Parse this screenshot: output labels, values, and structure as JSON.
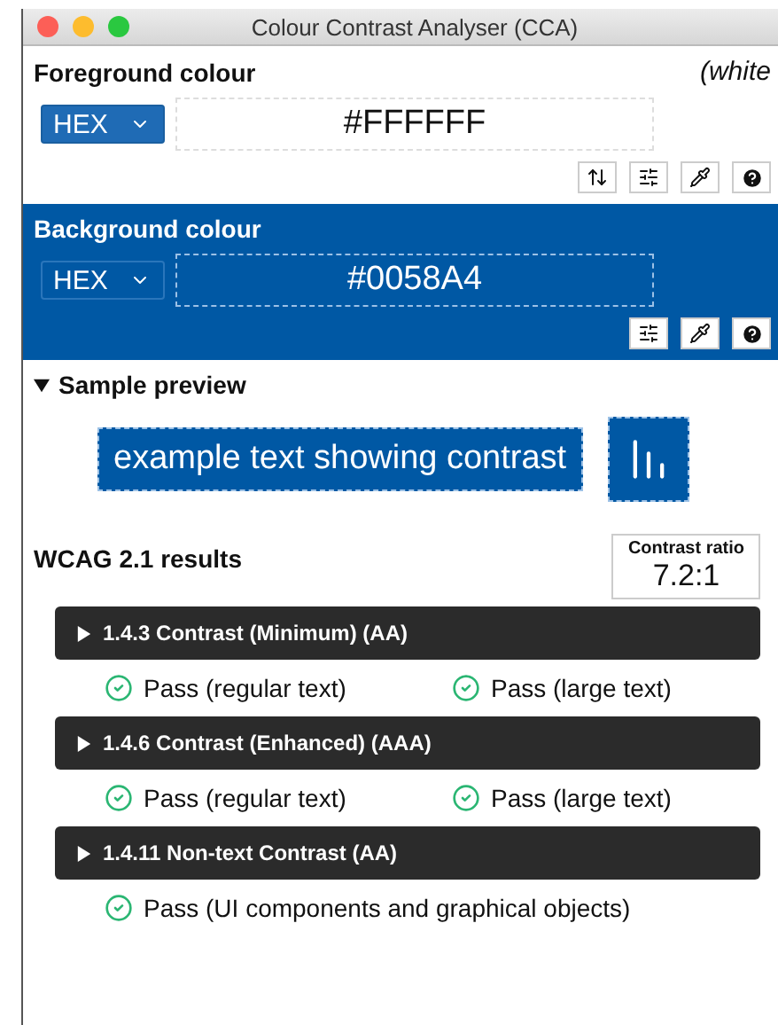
{
  "window": {
    "title": "Colour Contrast Analyser (CCA)"
  },
  "foreground": {
    "title": "Foreground colour",
    "name": "(white",
    "format": "HEX",
    "value": "#FFFFFF",
    "tools": [
      {
        "kind": "swap"
      },
      {
        "kind": "adjust"
      },
      {
        "kind": "picker"
      },
      {
        "kind": "help"
      }
    ]
  },
  "background": {
    "title": "Background colour",
    "format": "HEX",
    "value": "#0058A4",
    "tools": [
      {
        "kind": "adjust"
      },
      {
        "kind": "picker"
      },
      {
        "kind": "help"
      }
    ]
  },
  "sample": {
    "title": "Sample preview",
    "expanded": true,
    "text": "example text showing contrast"
  },
  "results": {
    "title": "WCAG 2.1 results",
    "ratio_label": "Contrast ratio",
    "ratio": "7.2:1",
    "criteria": [
      {
        "label": "1.4.3 Contrast (Minimum) (AA)",
        "expanded": false,
        "checks": [
          {
            "text": "Pass (regular text)",
            "passed": true
          },
          {
            "text": "Pass (large text)",
            "passed": true
          }
        ]
      },
      {
        "label": "1.4.6 Contrast (Enhanced) (AAA)",
        "expanded": false,
        "checks": [
          {
            "text": "Pass (regular text)",
            "passed": true
          },
          {
            "text": "Pass (large text)",
            "passed": true
          }
        ]
      },
      {
        "label": "1.4.11 Non-text Contrast (AA)",
        "expanded": false,
        "checks": [
          {
            "text": "Pass (UI components and graphical objects)",
            "passed": true
          }
        ]
      }
    ]
  }
}
